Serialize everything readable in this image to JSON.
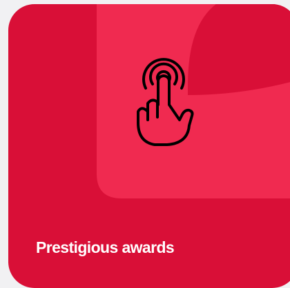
{
  "card": {
    "title": "Prestigious awards",
    "icon": "tap-gesture-icon",
    "colors": {
      "background": "#d90f37",
      "shape": "#f02a50",
      "title": "#ffffff",
      "icon_stroke": "#000000"
    }
  }
}
